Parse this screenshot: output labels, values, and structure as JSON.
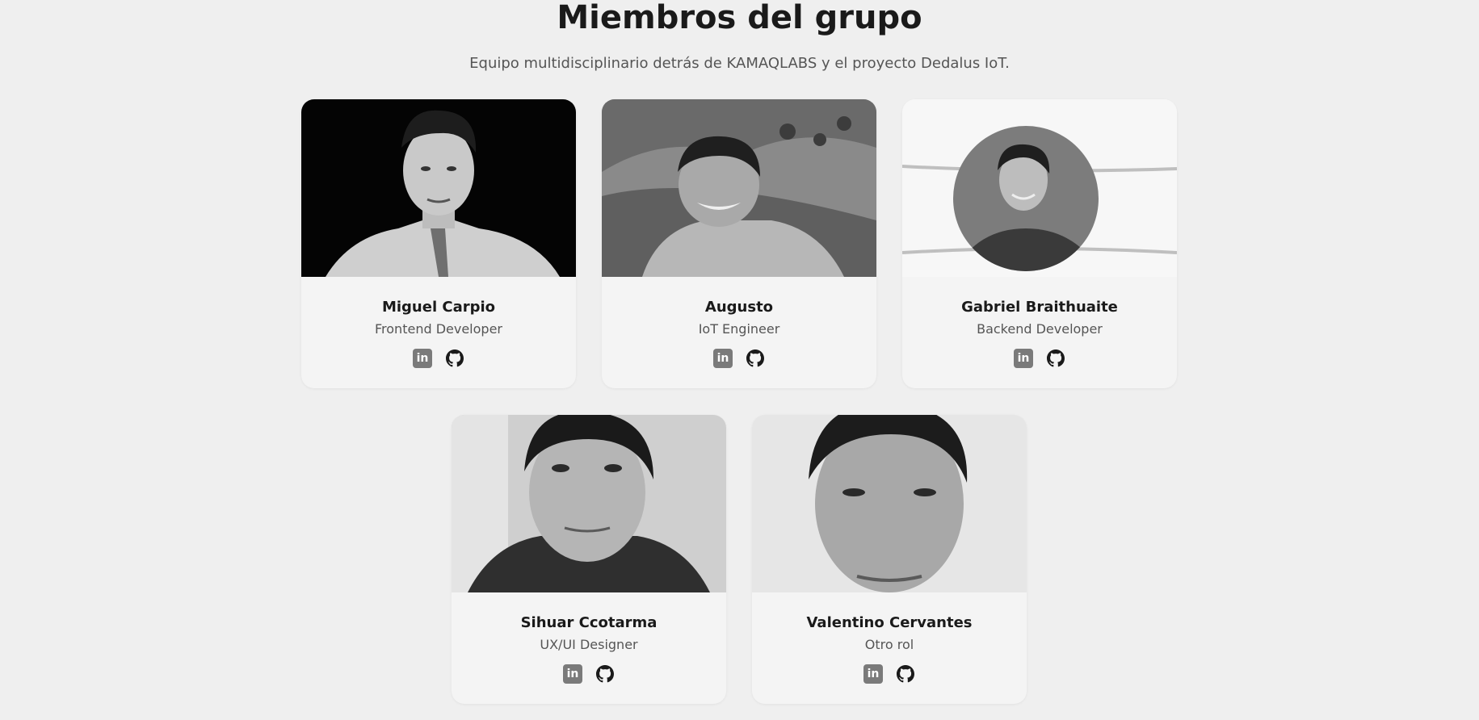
{
  "header": {
    "title": "Miembros del grupo",
    "subtitle": "Equipo multidisciplinario detrás de KAMAQLABS y el proyecto Dedalus IoT."
  },
  "members": [
    {
      "name": "Miguel Carpio",
      "role": "Frontend Developer"
    },
    {
      "name": "Augusto",
      "role": "IoT Engineer"
    },
    {
      "name": "Gabriel Braithuaite",
      "role": "Backend Developer"
    },
    {
      "name": "Sihuar Ccotarma",
      "role": "UX/UI Designer"
    },
    {
      "name": "Valentino Cervantes",
      "role": "Otro rol"
    }
  ],
  "social": {
    "linkedin_glyph": "in",
    "github_icon": "github-icon"
  },
  "colors": {
    "background": "#efefef",
    "card": "#f4f4f4",
    "text": "#1a1a1a",
    "muted": "#555555",
    "icon": "#7a7a7a"
  }
}
